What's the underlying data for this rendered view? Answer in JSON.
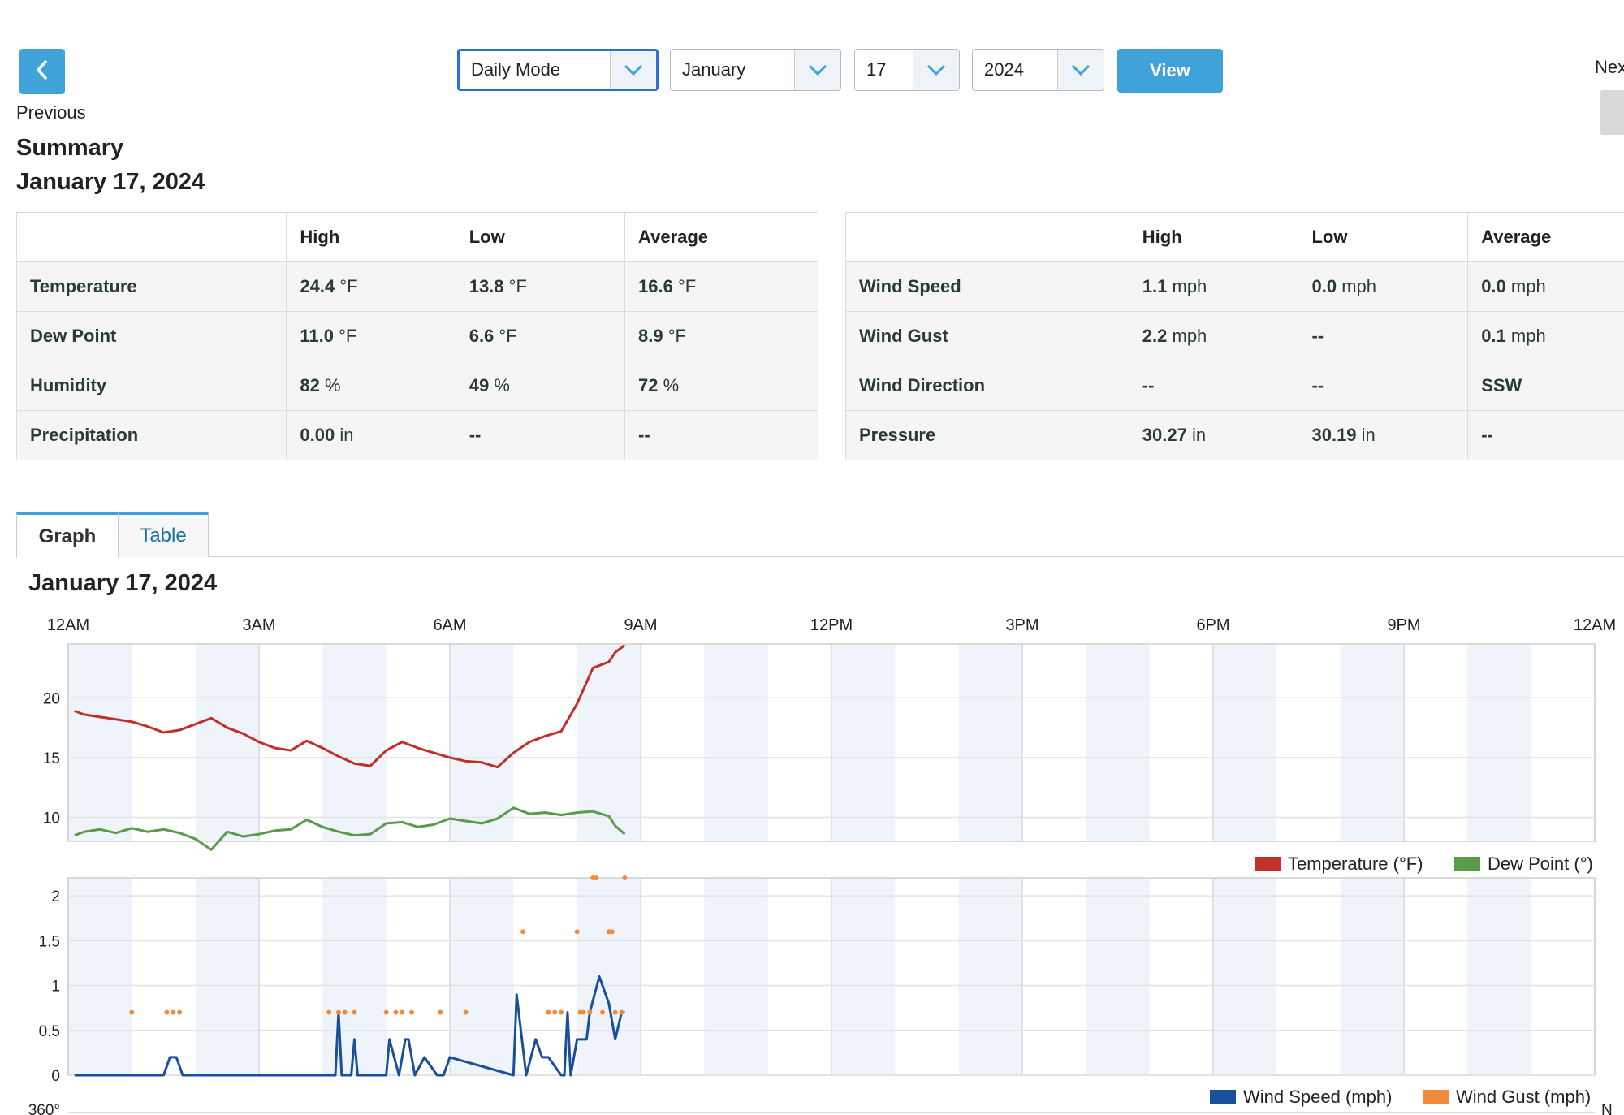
{
  "nav": {
    "previous_label": "Previous",
    "next_label": "Nex"
  },
  "selectors": {
    "mode": "Daily Mode",
    "month": "January",
    "day": "17",
    "year": "2024",
    "view_label": "View"
  },
  "summary": {
    "heading": "Summary",
    "date": "January 17, 2024",
    "headers": [
      "",
      "High",
      "Low",
      "Average"
    ],
    "left_rows": [
      {
        "label": "Temperature",
        "high": "24.4",
        "high_unit": "°F",
        "low": "13.8",
        "low_unit": "°F",
        "avg": "16.6",
        "avg_unit": "°F"
      },
      {
        "label": "Dew Point",
        "high": "11.0",
        "high_unit": "°F",
        "low": "6.6",
        "low_unit": "°F",
        "avg": "8.9",
        "avg_unit": "°F"
      },
      {
        "label": "Humidity",
        "high": "82",
        "high_unit": "%",
        "low": "49",
        "low_unit": "%",
        "avg": "72",
        "avg_unit": "%"
      },
      {
        "label": "Precipitation",
        "high": "0.00",
        "high_unit": "in",
        "low": "--",
        "low_unit": "",
        "avg": "--",
        "avg_unit": ""
      }
    ],
    "right_rows": [
      {
        "label": "Wind Speed",
        "high": "1.1",
        "high_unit": "mph",
        "low": "0.0",
        "low_unit": "mph",
        "avg": "0.0",
        "avg_unit": "mph"
      },
      {
        "label": "Wind Gust",
        "high": "2.2",
        "high_unit": "mph",
        "low": "--",
        "low_unit": "",
        "avg": "0.1",
        "avg_unit": "mph"
      },
      {
        "label": "Wind Direction",
        "high": "--",
        "high_unit": "",
        "low": "--",
        "low_unit": "",
        "avg": "SSW",
        "avg_unit": ""
      },
      {
        "label": "Pressure",
        "high": "30.27",
        "high_unit": "in",
        "low": "30.19",
        "low_unit": "in",
        "avg": "--",
        "avg_unit": ""
      }
    ]
  },
  "tabs": [
    {
      "label": "Graph",
      "active": true
    },
    {
      "label": "Table",
      "active": false
    }
  ],
  "graph_title": "January 17, 2024",
  "colors": {
    "accent": "#3fa2d8",
    "temperature": "#c0302b",
    "dew_point": "#5a9a4a",
    "wind_speed": "#1a4f9c",
    "wind_gust": "#f08a3c"
  },
  "chart_data": [
    {
      "type": "line",
      "title": "",
      "x_ticks": [
        "12AM",
        "3AM",
        "6AM",
        "9AM",
        "12PM",
        "3PM",
        "6PM",
        "9PM",
        "12AM"
      ],
      "xlim_hours": [
        0,
        24
      ],
      "ylim": [
        8,
        24.5
      ],
      "y_ticks": [
        10,
        15,
        20
      ],
      "legend": "bottom-right",
      "series": [
        {
          "name": "Temperature (°F)",
          "color": "#c0302b",
          "x": [
            0.1,
            0.25,
            0.5,
            0.75,
            1.0,
            1.25,
            1.5,
            1.75,
            2.0,
            2.25,
            2.5,
            2.75,
            3.0,
            3.25,
            3.5,
            3.75,
            4.0,
            4.25,
            4.5,
            4.75,
            5.0,
            5.25,
            5.5,
            5.75,
            6.0,
            6.25,
            6.5,
            6.75,
            7.0,
            7.25,
            7.5,
            7.75,
            8.0,
            8.25,
            8.5,
            8.6,
            8.75
          ],
          "y": [
            18.9,
            18.6,
            18.4,
            18.2,
            18.0,
            17.6,
            17.1,
            17.3,
            17.8,
            18.3,
            17.5,
            17.0,
            16.3,
            15.8,
            15.6,
            16.4,
            15.8,
            15.1,
            14.5,
            14.3,
            15.6,
            16.3,
            15.8,
            15.4,
            15.0,
            14.7,
            14.6,
            14.2,
            15.4,
            16.3,
            16.8,
            17.2,
            19.5,
            22.5,
            23.0,
            23.8,
            24.4
          ]
        },
        {
          "name": "Dew Point (°)",
          "color": "#5a9a4a",
          "x": [
            0.1,
            0.25,
            0.5,
            0.75,
            1.0,
            1.25,
            1.5,
            1.75,
            2.0,
            2.25,
            2.5,
            2.75,
            3.0,
            3.25,
            3.5,
            3.75,
            4.0,
            4.25,
            4.5,
            4.75,
            5.0,
            5.25,
            5.5,
            5.75,
            6.0,
            6.25,
            6.5,
            6.75,
            7.0,
            7.25,
            7.5,
            7.75,
            8.0,
            8.25,
            8.5,
            8.6,
            8.75
          ],
          "y": [
            8.5,
            8.8,
            9.0,
            8.7,
            9.1,
            8.8,
            9.0,
            8.7,
            8.2,
            7.3,
            8.8,
            8.4,
            8.6,
            8.9,
            9.0,
            9.8,
            9.2,
            8.8,
            8.5,
            8.6,
            9.5,
            9.6,
            9.2,
            9.4,
            9.9,
            9.7,
            9.5,
            9.9,
            10.8,
            10.3,
            10.4,
            10.2,
            10.4,
            10.5,
            10.1,
            9.3,
            8.6
          ]
        }
      ]
    },
    {
      "type": "line",
      "title": "",
      "xlim_hours": [
        0,
        24
      ],
      "ylim": [
        0,
        2.2
      ],
      "y_ticks": [
        0,
        0.5,
        1,
        1.5,
        2
      ],
      "legend": "bottom-right",
      "series": [
        {
          "name": "Wind Speed (mph)",
          "color": "#1a4f9c",
          "x": [
            0.1,
            1.5,
            1.6,
            1.7,
            1.8,
            4.2,
            4.25,
            4.3,
            4.45,
            4.5,
            4.55,
            4.7,
            5.0,
            5.05,
            5.2,
            5.3,
            5.35,
            5.45,
            5.6,
            5.8,
            5.9,
            6.0,
            7.0,
            7.05,
            7.2,
            7.35,
            7.45,
            7.55,
            7.75,
            7.8,
            7.85,
            7.9,
            8.0,
            8.05,
            8.15,
            8.2,
            8.35,
            8.5,
            8.6,
            8.7,
            8.75
          ],
          "y": [
            0,
            0,
            0.2,
            0.2,
            0,
            0,
            0.7,
            0,
            0,
            0.4,
            0,
            0,
            0,
            0.4,
            0,
            0.4,
            0.4,
            0,
            0.2,
            0,
            0,
            0.2,
            0,
            0.9,
            0,
            0.4,
            0.2,
            0.2,
            0,
            0,
            0.7,
            0,
            0.4,
            0.4,
            0.4,
            0.7,
            1.1,
            0.8,
            0.4,
            0.7,
            0.7
          ]
        },
        {
          "name": "Wind Gust (mph)",
          "color": "#f08a3c",
          "style": "dots",
          "x": [
            1.0,
            1.55,
            1.65,
            1.75,
            4.1,
            4.25,
            4.35,
            4.5,
            5.0,
            5.15,
            5.25,
            5.4,
            5.85,
            6.25,
            7.15,
            7.55,
            7.65,
            7.75,
            8.0,
            8.05,
            8.1,
            8.2,
            8.25,
            8.3,
            8.4,
            8.5,
            8.55,
            8.6,
            8.7,
            8.75
          ],
          "y": [
            0.7,
            0.7,
            0.7,
            0.7,
            0.7,
            0.7,
            0.7,
            0.7,
            0.7,
            0.7,
            0.7,
            0.7,
            0.7,
            0.7,
            1.6,
            0.7,
            0.7,
            0.7,
            1.6,
            0.7,
            0.7,
            0.7,
            2.2,
            2.2,
            0.7,
            1.6,
            1.6,
            0.7,
            0.7,
            2.2
          ]
        }
      ]
    }
  ],
  "partial_labels": {
    "third_chart_y": "360°",
    "third_chart_right": "N"
  }
}
